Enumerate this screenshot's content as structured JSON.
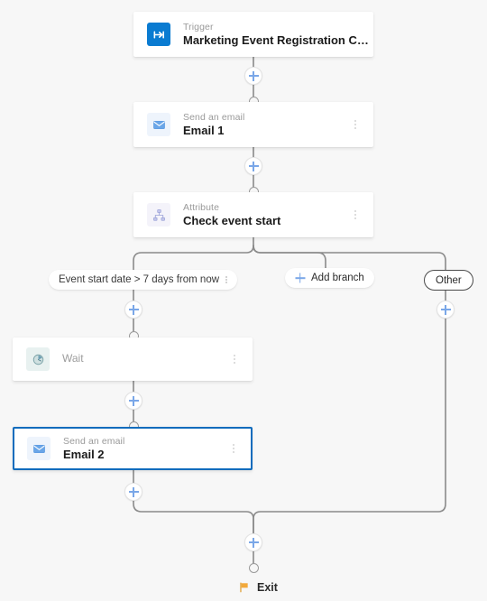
{
  "canvas": {
    "background": "#f7f7f7",
    "accent": "#0f6cbd",
    "connector_color": "#8a8a8a",
    "plus_color": "#7aa7e8"
  },
  "nodes": [
    {
      "id": "trigger",
      "kind": "Trigger",
      "title": "Marketing Event Registration Created",
      "icon": "trigger-arrow-icon",
      "icon_bg": "#0a7bd1",
      "selected": false,
      "has_kebab": false
    },
    {
      "id": "email1",
      "kind": "Send an email",
      "title": "Email 1",
      "icon": "envelope-icon",
      "icon_bg": "#eef4fc",
      "selected": false,
      "has_kebab": true
    },
    {
      "id": "attribute",
      "kind": "Attribute",
      "title": "Check event start",
      "icon": "hierarchy-icon",
      "icon_bg": "#f4f3fa",
      "selected": false,
      "has_kebab": true
    },
    {
      "id": "wait",
      "kind": "",
      "title": "Wait",
      "icon": "clock-icon",
      "icon_bg": "#e8f1f0",
      "selected": false,
      "has_kebab": true
    },
    {
      "id": "email2",
      "kind": "Send an email",
      "title": "Email 2",
      "icon": "envelope-icon",
      "icon_bg": "#eef4fc",
      "selected": true,
      "has_kebab": true
    }
  ],
  "branches": {
    "condition_label": "Event start date > 7 days from now",
    "add_branch_label": "Add branch",
    "other_label": "Other"
  },
  "exit": {
    "label": "Exit",
    "icon": "flag-icon",
    "color": "#f2a93b"
  },
  "add_buttons": [
    {
      "id": "add-after-trigger",
      "label": "+"
    },
    {
      "id": "add-after-email1",
      "label": "+"
    },
    {
      "id": "add-after-condition",
      "label": "+"
    },
    {
      "id": "add-after-wait",
      "label": "+"
    },
    {
      "id": "add-after-email2",
      "label": "+"
    },
    {
      "id": "add-on-other-branch",
      "label": "+"
    },
    {
      "id": "add-before-exit",
      "label": "+"
    }
  ]
}
